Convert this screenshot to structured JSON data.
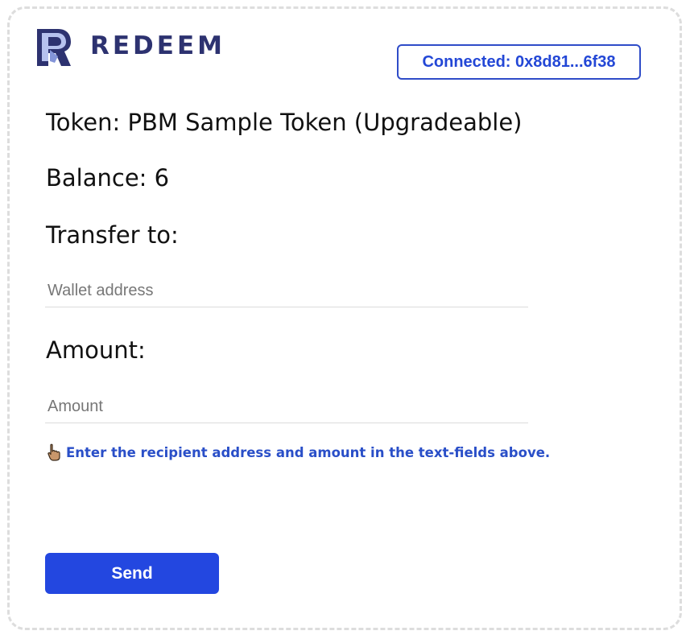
{
  "app": {
    "logo_text": "REDEEM",
    "logo_icon": "redeem-logo-icon"
  },
  "wallet": {
    "connected_label": "Connected: 0x8d81...6f38"
  },
  "token": {
    "token_line": "Token: PBM Sample Token (Upgradeable)",
    "balance_line": "Balance: 6"
  },
  "form": {
    "transfer_label": "Transfer to:",
    "address_placeholder": "Wallet address",
    "address_value": "",
    "amount_label": "Amount:",
    "amount_placeholder": "Amount",
    "amount_value": "",
    "hint_icon": "pointing-hand-icon",
    "hint_text": "Enter the recipient address and amount in the text-fields above.",
    "send_label": "Send"
  },
  "colors": {
    "brand": "#2d3270",
    "accent": "#2347e0",
    "link_text": "#2a4fc8"
  }
}
